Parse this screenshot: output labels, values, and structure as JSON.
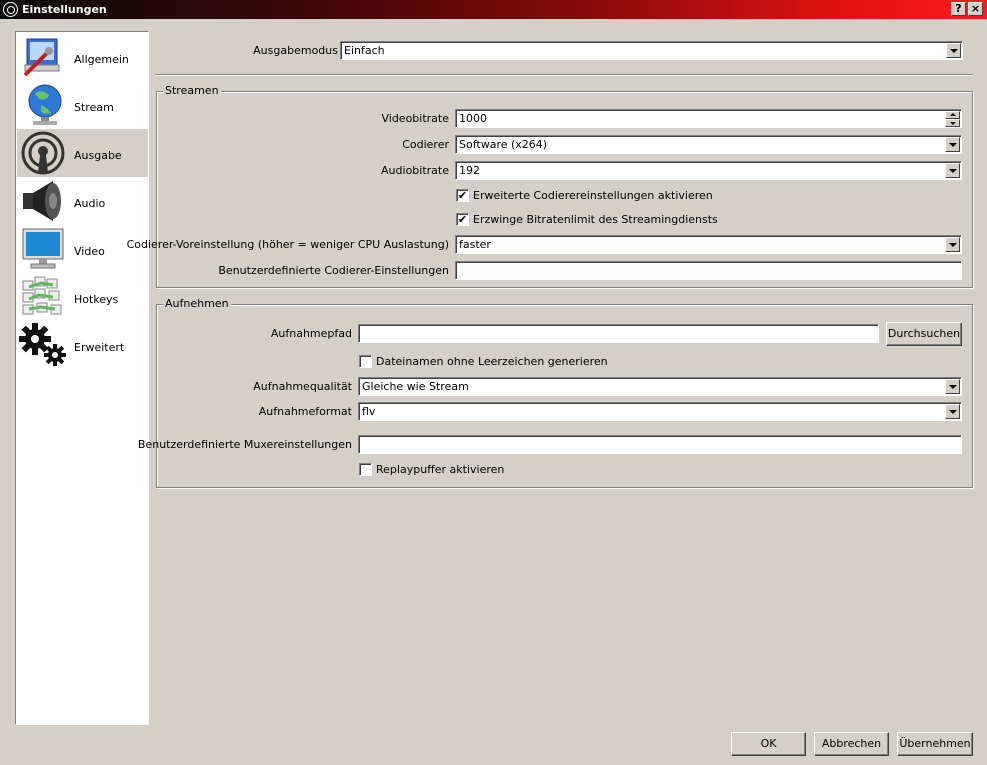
{
  "window": {
    "title": "Einstellungen",
    "help_label": "?",
    "close_label": "×"
  },
  "sidebar": {
    "items": [
      {
        "label": "Allgemein"
      },
      {
        "label": "Stream"
      },
      {
        "label": "Ausgabe"
      },
      {
        "label": "Audio"
      },
      {
        "label": "Video"
      },
      {
        "label": "Hotkeys"
      },
      {
        "label": "Erweitert"
      }
    ],
    "selected": "Ausgabe"
  },
  "output_mode": {
    "label": "Ausgabemodus",
    "value": "Einfach"
  },
  "streaming": {
    "title": "Streamen",
    "video_bitrate": {
      "label": "Videobitrate",
      "value": "1000"
    },
    "encoder": {
      "label": "Codierer",
      "value": "Software (x264)"
    },
    "audio_bitrate": {
      "label": "Audiobitrate",
      "value": "192"
    },
    "advanced_encoder": {
      "label": "Erweiterte Codierereinstellungen aktivieren",
      "checked": true,
      "mark": "✔"
    },
    "enforce_bitrate": {
      "label": "Erzwinge Bitratenlimit des Streamingdiensts",
      "checked": true,
      "mark": "✔"
    },
    "preset": {
      "label": "Codierer-Voreinstellung (höher = weniger CPU Auslastung)",
      "value": "faster"
    },
    "custom_settings": {
      "label": "Benutzerdefinierte Codierer-Einstellungen",
      "value": ""
    }
  },
  "recording": {
    "title": "Aufnehmen",
    "path": {
      "label": "Aufnahmepfad",
      "value": "",
      "browse_label": "Durchsuchen"
    },
    "no_spaces": {
      "label": "Dateinamen ohne Leerzeichen generieren",
      "checked": false,
      "mark": ""
    },
    "quality": {
      "label": "Aufnahmequalität",
      "value": "Gleiche wie Stream"
    },
    "format": {
      "label": "Aufnahmeformat",
      "value": "flv"
    },
    "muxer": {
      "label": "Benutzerdefinierte Muxereinstellungen",
      "value": ""
    },
    "replay_buffer": {
      "label": "Replaypuffer aktivieren",
      "checked": false,
      "mark": ""
    }
  },
  "footer": {
    "ok_label": "OK",
    "cancel_label": "Abbrechen",
    "apply_label": "Übernehmen"
  }
}
